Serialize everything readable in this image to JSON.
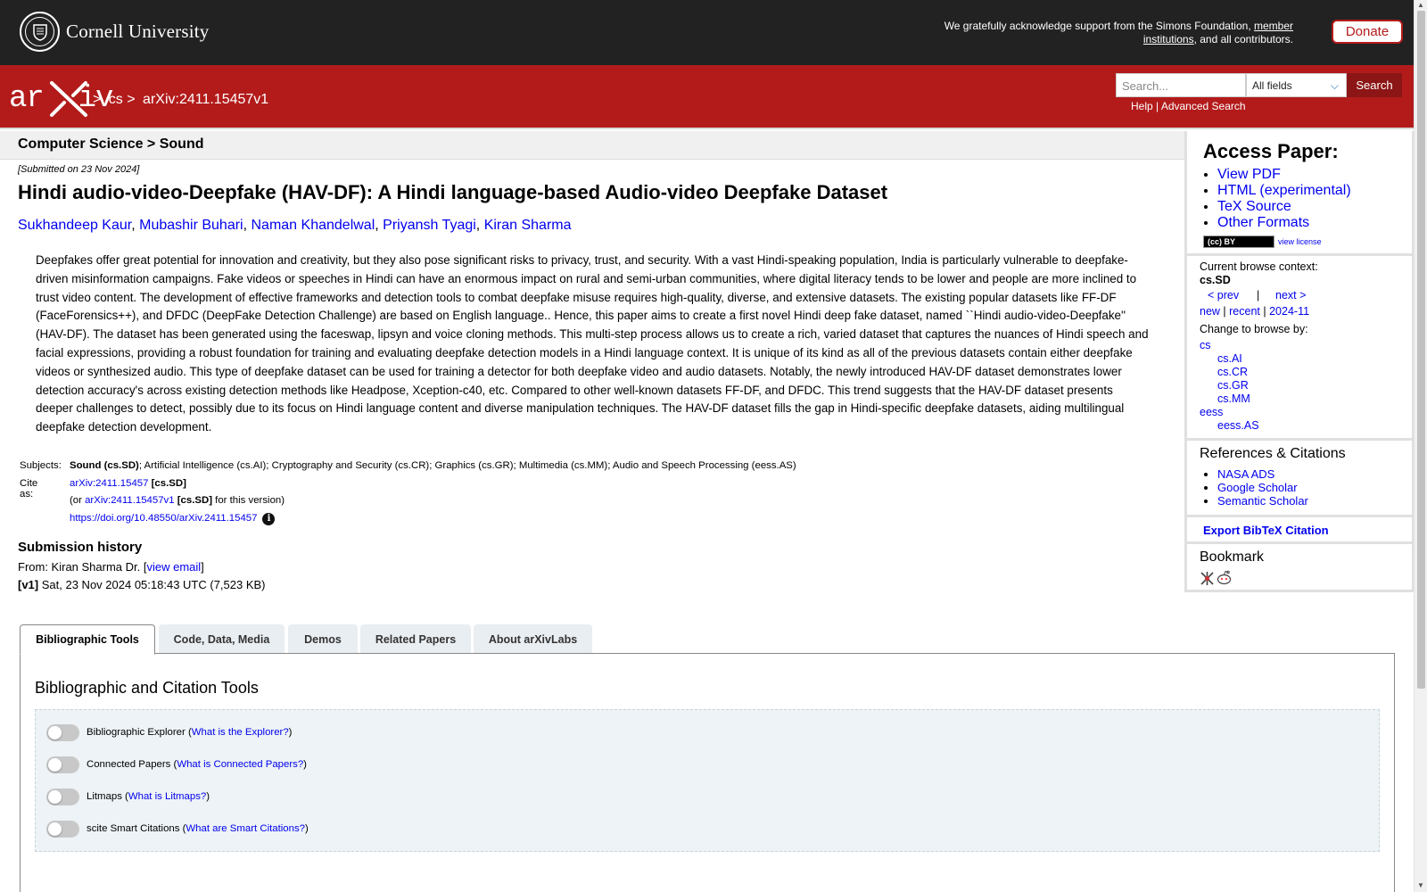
{
  "top": {
    "university": "Cornell University",
    "ack_text": "We gratefully acknowledge support from the Simons Foundation, ",
    "ack_link": "member institutions",
    "ack_tail": ", and all contributors.",
    "donate": "Donate"
  },
  "header": {
    "logo_text": "arXiv",
    "breadcrumb": [
      ">",
      "cs",
      ">",
      "arXiv:2411.15457v1"
    ],
    "search_placeholder": "Search...",
    "search_field": "All fields",
    "search_button": "Search",
    "help": "Help",
    "separator": " | ",
    "advanced": "Advanced Search"
  },
  "category": "Computer Science > Sound",
  "paper": {
    "submitted": "[Submitted on 23 Nov 2024]",
    "title": "Hindi audio-video-Deepfake (HAV-DF): A Hindi language-based Audio-video Deepfake Dataset",
    "authors": [
      "Sukhandeep Kaur",
      "Mubashir Buhari",
      "Naman Khandelwal",
      "Priyansh Tyagi",
      "Kiran Sharma"
    ],
    "abstract": "Deepfakes offer great potential for innovation and creativity, but they also pose significant risks to privacy, trust, and security. With a vast Hindi-speaking population, India is particularly vulnerable to deepfake-driven misinformation campaigns. Fake videos or speeches in Hindi can have an enormous impact on rural and semi-urban communities, where digital literacy tends to be lower and people are more inclined to trust video content. The development of effective frameworks and detection tools to combat deepfake misuse requires high-quality, diverse, and extensive datasets. The existing popular datasets like FF-DF (FaceForensics++), and DFDC (DeepFake Detection Challenge) are based on English language.. Hence, this paper aims to create a first novel Hindi deep fake dataset, named ``Hindi audio-video-Deepfake'' (HAV-DF). The dataset has been generated using the faceswap, lipsyn and voice cloning methods. This multi-step process allows us to create a rich, varied dataset that captures the nuances of Hindi speech and facial expressions, providing a robust foundation for training and evaluating deepfake detection models in a Hindi language context. It is unique of its kind as all of the previous datasets contain either deepfake videos or synthesized audio. This type of deepfake dataset can be used for training a detector for both deepfake video and audio datasets. Notably, the newly introduced HAV-DF dataset demonstrates lower detection accuracy's across existing detection methods like Headpose, Xception-c40, etc. Compared to other well-known datasets FF-DF, and DFDC. This trend suggests that the HAV-DF dataset presents deeper challenges to detect, possibly due to its focus on Hindi language content and diverse manipulation techniques. The HAV-DF dataset fills the gap in Hindi-specific deepfake datasets, aiding multilingual deepfake detection development.",
    "subjects_label": "Subjects:",
    "subjects_primary": "Sound (cs.SD)",
    "subjects_rest": "; Artificial Intelligence (cs.AI); Cryptography and Security (cs.CR); Graphics (cs.GR); Multimedia (cs.MM); Audio and Speech Processing (eess.AS)",
    "cite_label": "Cite as:",
    "cite_id": "arXiv:2411.15457",
    "cite_cat": "[cs.SD]",
    "cite_or": "(or ",
    "cite_version": "arXiv:2411.15457v1",
    "cite_version_tail": "for this version)",
    "doi": "https://doi.org/10.48550/arXiv.2411.15457",
    "info_icon": "i",
    "history_heading": "Submission history",
    "from_text": "From: Kiran Sharma Dr. [",
    "view_email": "view email",
    "from_close": "]",
    "v1_label": "[v1]",
    "v1_text": "Sat, 23 Nov 2024 05:18:43 UTC (7,523 KB)"
  },
  "sidebar": {
    "access_heading": "Access Paper:",
    "access_links": [
      "View PDF",
      "HTML (experimental)",
      "TeX Source",
      "Other Formats"
    ],
    "license_badge": "(cc) BY",
    "view_license": "view license",
    "browse_context_label": "Current browse context:",
    "browse_context": "cs.SD",
    "prev": "< prev",
    "pipe": "|",
    "next": "next >",
    "new": "new",
    "recent": "recent",
    "month": "2024-11",
    "change_label": "Change to browse by:",
    "cats": [
      "cs",
      "cs.AI",
      "cs.CR",
      "cs.GR",
      "cs.MM",
      "eess",
      "eess.AS"
    ],
    "refs_heading": "References & Citations",
    "refs": [
      "NASA ADS",
      "Google Scholar",
      "Semantic Scholar"
    ],
    "bibtex": "Export BibTeX Citation",
    "bookmark_heading": "Bookmark"
  },
  "tabs": {
    "labels": [
      "Bibliographic Tools",
      "Code, Data, Media",
      "Demos",
      "Related Papers",
      "About arXivLabs"
    ],
    "panel_heading": "Bibliographic and Citation Tools",
    "tools": [
      {
        "name": "Bibliographic Explorer",
        "link": "What is the Explorer?"
      },
      {
        "name": "Connected Papers",
        "link": "What is Connected Papers?"
      },
      {
        "name": "Litmaps",
        "link": "What is Litmaps?"
      },
      {
        "name": "scite Smart Citations",
        "link": "What are Smart Citations?"
      }
    ]
  },
  "colors": {
    "brand_red": "#b31b1b",
    "dark": "#222222",
    "link": "#0000ee"
  }
}
